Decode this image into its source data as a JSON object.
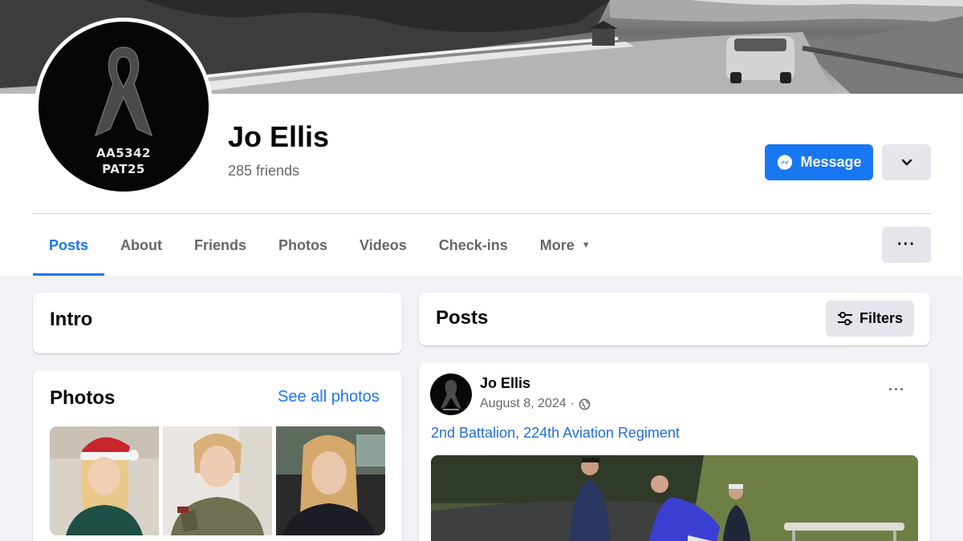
{
  "profile": {
    "name": "Jo Ellis",
    "friends": "285 friends",
    "avatar_text_line1": "AA5342",
    "avatar_text_line2": "PAT25",
    "avatar_icon": "mourning-ribbon-icon"
  },
  "actions": {
    "message_label": "Message",
    "message_icon": "messenger-icon",
    "dropdown_icon": "chevron-down-icon",
    "more_icon": "ellipsis-icon"
  },
  "tabs": [
    {
      "label": "Posts",
      "active": true
    },
    {
      "label": "About",
      "active": false
    },
    {
      "label": "Friends",
      "active": false
    },
    {
      "label": "Photos",
      "active": false
    },
    {
      "label": "Videos",
      "active": false
    },
    {
      "label": "Check-ins",
      "active": false
    },
    {
      "label": "More",
      "active": false
    }
  ],
  "intro": {
    "title": "Intro"
  },
  "photos": {
    "title": "Photos",
    "see_all": "See all photos"
  },
  "posts": {
    "title": "Posts",
    "filters_label": "Filters",
    "filters_icon": "sliders-icon"
  },
  "post": {
    "author": "Jo Ellis",
    "date": "August 8, 2024",
    "separator": "·",
    "audience_icon": "globe-icon",
    "text": "2nd Battalion, 224th Aviation Regiment",
    "options_icon": "ellipsis-icon"
  },
  "colors": {
    "accent": "#1877f2",
    "background": "#f0f2f5",
    "secondary_text": "#65676b",
    "button_gray": "#e4e6eb"
  }
}
